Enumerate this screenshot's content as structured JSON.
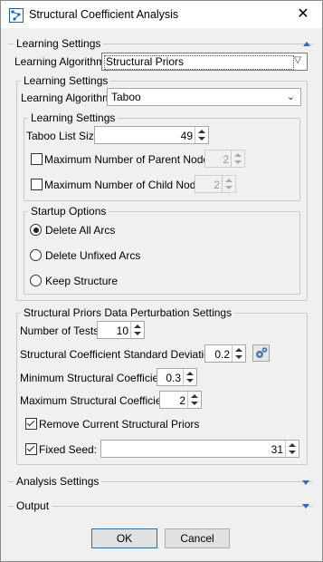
{
  "window": {
    "title": "Structural Coefficient Analysis",
    "close_glyph": "✕"
  },
  "learning": {
    "legend": "Learning Settings",
    "algorithm_label": "Learning Algorithm",
    "algorithm_value": "Structural Priors",
    "inner": {
      "legend": "Learning Settings",
      "algorithm_label": "Learning Algorithm",
      "algorithm_value": "Taboo",
      "inner": {
        "legend": "Learning Settings",
        "taboo_label": "Taboo List Size",
        "taboo_value": "49",
        "max_parent_label": "Maximum Number of Parent Nodes",
        "max_parent_value": "2",
        "max_child_label": "Maximum Number of Child Nodes",
        "max_child_value": "2"
      },
      "startup": {
        "legend": "Startup Options",
        "options": [
          "Delete All Arcs",
          "Delete Unfixed Arcs",
          "Keep Structure"
        ],
        "selected": "Delete All Arcs"
      }
    },
    "perturb": {
      "legend": "Structural Priors Data Perturbation Settings",
      "tests_label": "Number of Tests",
      "tests_value": "10",
      "std_label": "Structural Coefficient Standard Deviation",
      "std_value": "0.2",
      "min_label": "Minimum Structural Coefficient",
      "min_value": "0.3",
      "max_label": "Maximum Structural Coefficient",
      "max_value": "2",
      "remove_label": "Remove Current Structural Priors",
      "remove_checked": true,
      "seed_label": "Fixed Seed:",
      "seed_checked": true,
      "seed_value": "31"
    }
  },
  "analysis": {
    "legend": "Analysis Settings"
  },
  "output": {
    "legend": "Output"
  },
  "buttons": {
    "ok": "OK",
    "cancel": "Cancel"
  },
  "colors": {
    "accent": "#2d6bc9",
    "default_button_border": "#0078d7"
  }
}
